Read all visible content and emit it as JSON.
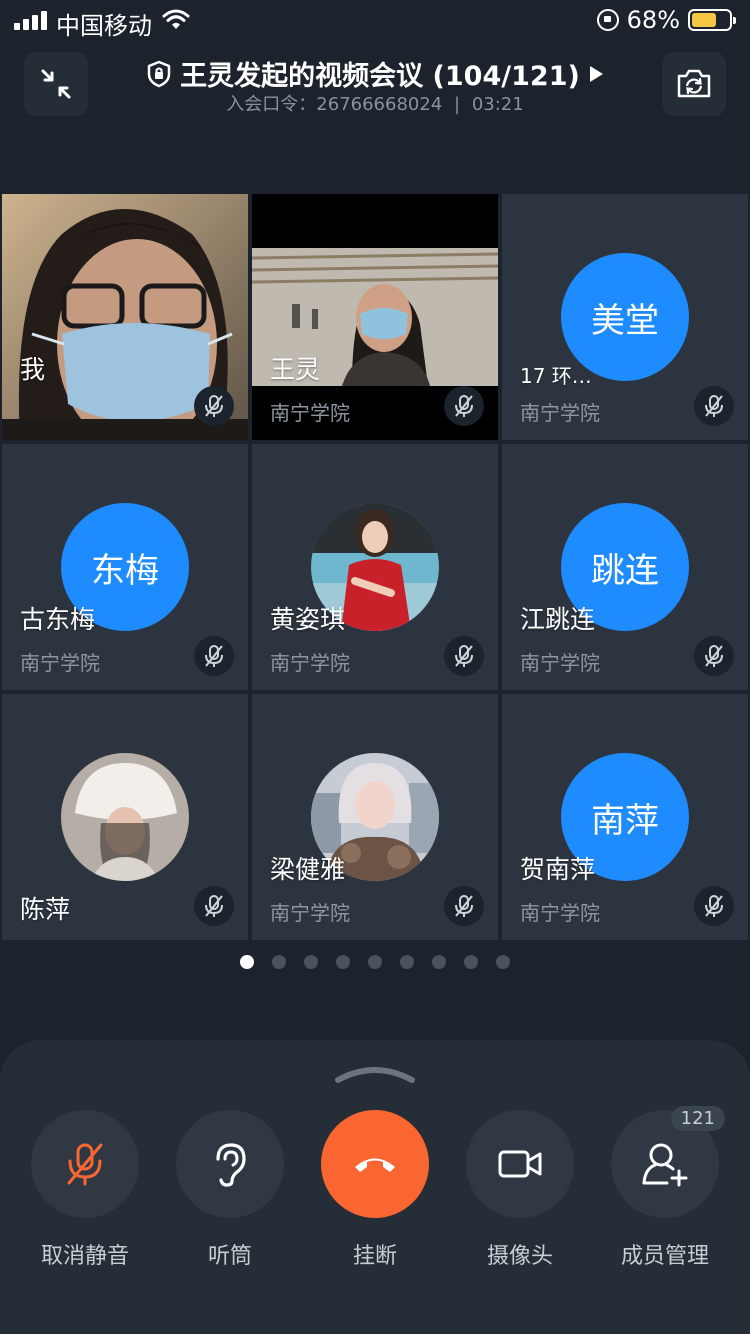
{
  "status_bar": {
    "carrier": "中国移动",
    "battery_percent": "68%",
    "battery_level": 0.68,
    "battery_color": "#f6c744"
  },
  "header": {
    "title": "王灵发起的视频会议 (104/121)",
    "subtitle_label": "入会口令：26766668024",
    "separator": "|",
    "duration": "03:21",
    "left_icon": "collapse-arrows-icon",
    "right_icon": "switch-camera-icon"
  },
  "tiles": [
    {
      "name": "我",
      "org": "",
      "kind": "video"
    },
    {
      "name": "王灵",
      "org": "南宁学院",
      "kind": "video"
    },
    {
      "name": "17 环…",
      "org": "南宁学院",
      "kind": "text",
      "avatar_text": "美堂"
    },
    {
      "name": "古东梅",
      "org": "南宁学院",
      "kind": "text",
      "avatar_text": "东梅"
    },
    {
      "name": "黄姿琪",
      "org": "南宁学院",
      "kind": "photo"
    },
    {
      "name": "江跳连",
      "org": "南宁学院",
      "kind": "text",
      "avatar_text": "跳连"
    },
    {
      "name": "陈萍",
      "org": "",
      "kind": "photo"
    },
    {
      "name": "梁健雅",
      "org": "南宁学院",
      "kind": "photo"
    },
    {
      "name": "贺南萍",
      "org": "南宁学院",
      "kind": "text",
      "avatar_text": "南萍"
    }
  ],
  "pagination": {
    "total": 9,
    "current": 1
  },
  "controls": [
    {
      "label": "取消静音",
      "icon": "mic-muted-icon"
    },
    {
      "label": "听筒",
      "icon": "ear-icon"
    },
    {
      "label": "挂断",
      "icon": "hangup-icon"
    },
    {
      "label": "摄像头",
      "icon": "video-camera-icon"
    },
    {
      "label": "成员管理",
      "icon": "add-member-icon",
      "badge": "121"
    }
  ],
  "colors": {
    "accent_blue": "#1e8bff",
    "hangup_orange": "#f96632",
    "background": "#1c232c"
  }
}
